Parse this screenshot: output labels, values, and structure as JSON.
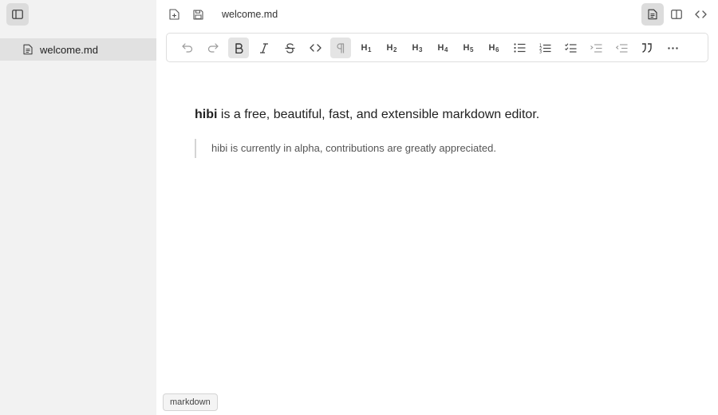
{
  "sidebar": {
    "files": [
      {
        "label": "welcome.md"
      }
    ]
  },
  "topbar": {
    "title": "welcome.md"
  },
  "toolbar": {
    "headings": [
      {
        "label": "H",
        "level": "1"
      },
      {
        "label": "H",
        "level": "2"
      },
      {
        "label": "H",
        "level": "3"
      },
      {
        "label": "H",
        "level": "4"
      },
      {
        "label": "H",
        "level": "5"
      },
      {
        "label": "H",
        "level": "6"
      }
    ]
  },
  "editor": {
    "paragraph_bold": "hibi",
    "paragraph_rest": " is a free, beautiful, fast, and extensible markdown editor.",
    "blockquote": "hibi is currently in alpha, contributions are greatly appreciated."
  },
  "statusbar": {
    "mode_label": "markdown"
  }
}
